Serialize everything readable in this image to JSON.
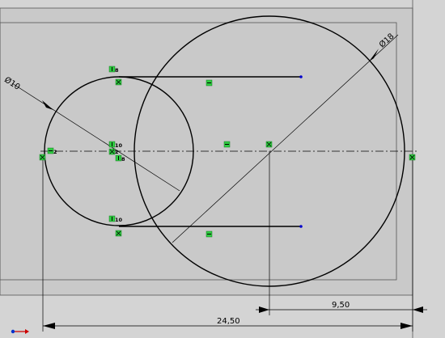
{
  "app": "CAD sketch viewport",
  "colors": {
    "background": "#d4d4d4",
    "sheet": "#c8c8c8",
    "geometry": "#000000",
    "relation_badge": "#2ecc40",
    "endpoint": "#0000cc",
    "origin_arrow_x": "#cc0000",
    "origin_arrow_y": "#0033cc"
  },
  "dimensions": {
    "small_circle_diameter": "Ø10",
    "large_circle_diameter": "Ø18",
    "horizontal_short": "9,50",
    "horizontal_long": "24,50"
  },
  "relations": {
    "tangent_top": "8",
    "tangent_mid": "10",
    "coincident_mid": "2",
    "tangent_mid_lower": "8",
    "tangent_bottom": "10",
    "coincident_left": "2"
  },
  "icons": [
    "horizontal-relation-icon",
    "coincident-relation-icon",
    "tangent-relation-icon",
    "origin-icon"
  ]
}
